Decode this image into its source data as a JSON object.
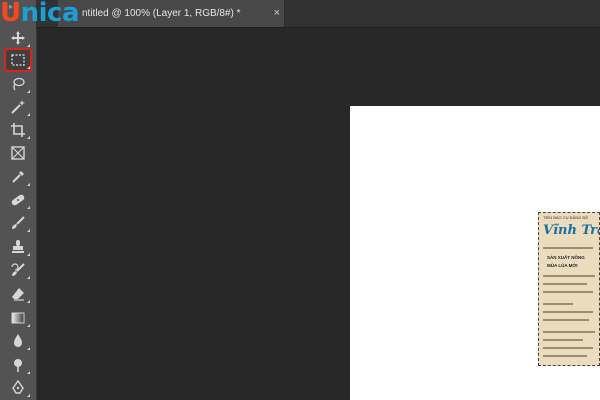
{
  "app": {
    "logo": {
      "first": "U",
      "rest": "nica",
      "brand_colors": {
        "orange": "#f04a23",
        "blue": "#1aa0d6"
      }
    },
    "document_tab": {
      "title": "ntitled @ 100% (Layer 1, RGB/8#) *",
      "close": "×"
    },
    "toolbar": {
      "tools": [
        {
          "name": "move-tool",
          "icon": "move-icon"
        },
        {
          "name": "rectangular-marquee-tool",
          "icon": "marquee-icon",
          "selected": true,
          "highlight_color": "#e0201b"
        },
        {
          "name": "lasso-tool",
          "icon": "lasso-icon"
        },
        {
          "name": "magic-wand-tool",
          "icon": "magic-wand-icon"
        },
        {
          "name": "crop-tool",
          "icon": "crop-icon"
        },
        {
          "name": "frame-tool",
          "icon": "frame-icon"
        },
        {
          "name": "eyedropper-tool",
          "icon": "eyedropper-icon"
        },
        {
          "name": "healing-brush-tool",
          "icon": "bandage-icon"
        },
        {
          "name": "brush-tool",
          "icon": "brush-icon"
        },
        {
          "name": "clone-stamp-tool",
          "icon": "stamp-icon"
        },
        {
          "name": "history-brush-tool",
          "icon": "history-brush-icon"
        },
        {
          "name": "eraser-tool",
          "icon": "eraser-icon"
        },
        {
          "name": "gradient-tool",
          "icon": "gradient-icon"
        },
        {
          "name": "blur-tool",
          "icon": "blur-icon"
        },
        {
          "name": "dodge-tool",
          "icon": "dodge-icon"
        },
        {
          "name": "pen-tool",
          "icon": "pen-icon"
        }
      ]
    },
    "newspaper": {
      "masthead": "Vĩnh Trà",
      "top_text": "TIẾN BÁO CỤ ĐẢNG BỘ",
      "headline_1": "SẢN XUẤT NÔNG",
      "headline_2": "MÙA LÚA MỚI"
    }
  }
}
